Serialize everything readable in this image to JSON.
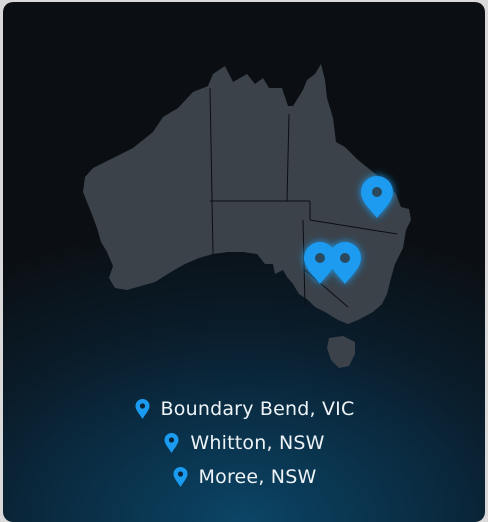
{
  "colors": {
    "accent": "#1a9bf0",
    "land": "#3b424a",
    "border_lines": "#0b0f13",
    "text": "#eef3f7"
  },
  "map": {
    "icon": "map-pin-icon",
    "markers": [
      {
        "location": "Moree, NSW"
      },
      {
        "location": "Whitton, NSW"
      },
      {
        "location": "Boundary Bend, VIC"
      }
    ]
  },
  "locations": [
    {
      "label": "Boundary Bend, VIC",
      "icon": "map-pin-icon"
    },
    {
      "label": "Whitton, NSW",
      "icon": "map-pin-icon"
    },
    {
      "label": "Moree, NSW",
      "icon": "map-pin-icon"
    }
  ]
}
